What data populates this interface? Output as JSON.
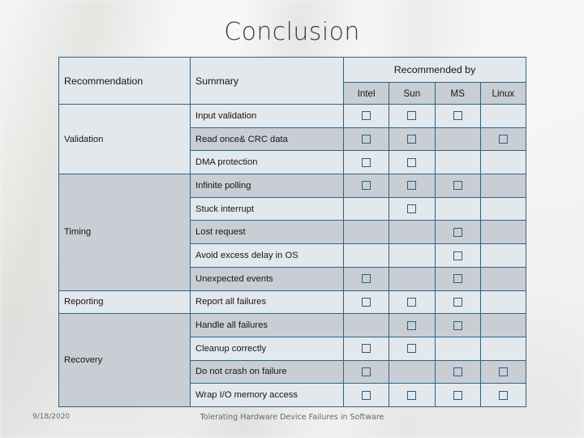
{
  "slide": {
    "title": "Conclusion"
  },
  "table": {
    "headers": {
      "recommendation": "Recommendation",
      "summary": "Summary",
      "recommended_by": "Recommended by",
      "vendors": [
        "Intel",
        "Sun",
        "MS",
        "Linux"
      ]
    },
    "groups": [
      {
        "label": "Validation",
        "rows": 3,
        "shade": "light"
      },
      {
        "label": "Timing",
        "rows": 5,
        "shade": "dark"
      },
      {
        "label": "Reporting",
        "rows": 1,
        "shade": "light"
      },
      {
        "label": "Recovery",
        "rows": 4,
        "shade": "dark"
      }
    ],
    "rows": [
      {
        "category": "Validation",
        "summary": "Input validation",
        "marks": [
          true,
          true,
          true,
          false
        ],
        "shade": "light"
      },
      {
        "category": "",
        "summary": "Read once& CRC data",
        "marks": [
          true,
          true,
          false,
          true
        ],
        "shade": "dark"
      },
      {
        "category": "",
        "summary": "DMA protection",
        "marks": [
          true,
          true,
          false,
          false
        ],
        "shade": "light"
      },
      {
        "category": "Timing",
        "summary": "Infinite polling",
        "marks": [
          true,
          true,
          true,
          false
        ],
        "shade": "dark"
      },
      {
        "category": "",
        "summary": "Stuck interrupt",
        "marks": [
          false,
          true,
          false,
          false
        ],
        "shade": "light"
      },
      {
        "category": "",
        "summary": "Lost request",
        "marks": [
          false,
          false,
          true,
          false
        ],
        "shade": "dark"
      },
      {
        "category": "",
        "summary": "Avoid excess delay in OS",
        "marks": [
          false,
          false,
          true,
          false
        ],
        "shade": "light"
      },
      {
        "category": "",
        "summary": "Unexpected events",
        "marks": [
          true,
          false,
          true,
          false
        ],
        "shade": "dark"
      },
      {
        "category": "Reporting",
        "summary": "Report all failures",
        "marks": [
          true,
          true,
          true,
          false
        ],
        "shade": "light"
      },
      {
        "category": "Recovery",
        "summary": "Handle all failures",
        "marks": [
          false,
          true,
          true,
          false
        ],
        "shade": "dark"
      },
      {
        "category": "",
        "summary": "Cleanup correctly",
        "marks": [
          true,
          true,
          false,
          false
        ],
        "shade": "light"
      },
      {
        "category": "",
        "summary": "Do not crash on failure",
        "marks": [
          true,
          false,
          true,
          true
        ],
        "shade": "dark"
      },
      {
        "category": "",
        "summary": "Wrap I/O memory access",
        "marks": [
          true,
          true,
          true,
          true
        ],
        "shade": "light"
      }
    ],
    "checkbox_glyph": "checkbox-empty-icon",
    "border_color": "#2e6389",
    "shade_light": "#e3e8ed",
    "shade_dark": "#c9ced5"
  },
  "footer": {
    "date": "9/18/2020",
    "deck_title": "Tolerating Hardware Device Failures in Software"
  }
}
